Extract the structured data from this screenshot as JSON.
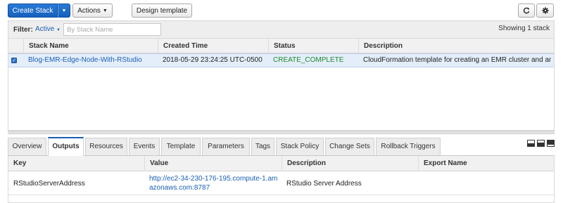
{
  "toolbar": {
    "create_label": "Create Stack",
    "actions_label": "Actions",
    "design_label": "Design template"
  },
  "filter": {
    "label": "Filter:",
    "active_label": "Active",
    "placeholder": "By Stack Name",
    "showing": "Showing 1 stack"
  },
  "stacks": {
    "columns": [
      "Stack Name",
      "Created Time",
      "Status",
      "Description"
    ],
    "rows": [
      {
        "selected": true,
        "name": "Blog-EMR-Edge-Node-With-RStudio",
        "created": "2018-05-29 23:24:25 UTC-0500",
        "status": "CREATE_COMPLETE",
        "description": "CloudFormation template for creating an EMR cluster and an …"
      }
    ]
  },
  "tabs": [
    "Overview",
    "Outputs",
    "Resources",
    "Events",
    "Template",
    "Parameters",
    "Tags",
    "Stack Policy",
    "Change Sets",
    "Rollback Triggers"
  ],
  "active_tab": "Outputs",
  "outputs": {
    "columns": [
      "Key",
      "Value",
      "Description",
      "Export Name"
    ],
    "rows": [
      {
        "key": "RStudioServerAddress",
        "value": "http://ec2-34-230-176-195.compute-1.amazonaws.com:8787",
        "description": "RStudio Server Address",
        "export_name": ""
      }
    ]
  },
  "colors": {
    "primary": "#1560bd",
    "link": "#1a5fb4",
    "status_complete": "#1e8a2a",
    "selected_row": "#e4eefa"
  },
  "icons": [
    "chevron-down-icon",
    "refresh-icon",
    "gear-icon",
    "checkbox-checked-icon",
    "layout-bottom-icon",
    "layout-split-icon",
    "layout-top-icon"
  ]
}
